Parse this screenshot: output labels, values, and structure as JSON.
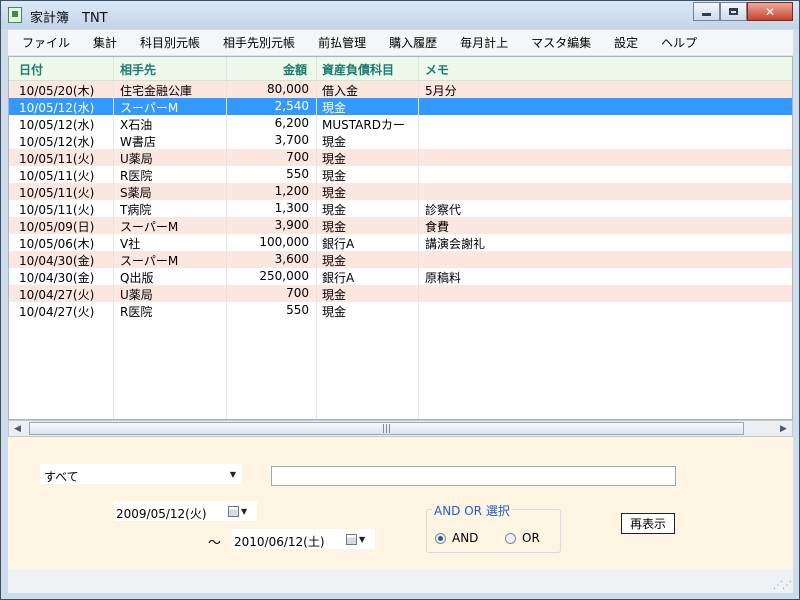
{
  "window": {
    "title": "家計簿　TNT"
  },
  "menu": [
    "ファイル",
    "集計",
    "科目別元帳",
    "相手先別元帳",
    "前払管理",
    "購入履歴",
    "毎月計上",
    "マスタ編集",
    "設定",
    "ヘルプ"
  ],
  "grid": {
    "headers": {
      "date": "日付",
      "partner": "相手先",
      "amount": "金額",
      "account": "資産負債科目",
      "memo": "メモ"
    },
    "rows": [
      {
        "date": "10/05/20(木)",
        "partner": "住宅金融公庫",
        "amount": "80,000",
        "account": "借入金",
        "memo": " 5月分",
        "style": "pink"
      },
      {
        "date": "10/05/12(水)",
        "partner": "スーパーM",
        "amount": "2,540",
        "account": "現金",
        "memo": "",
        "style": "sel"
      },
      {
        "date": "10/05/12(水)",
        "partner": "X石油",
        "amount": "6,200",
        "account": "MUSTARDカー",
        "memo": "",
        "style": "white"
      },
      {
        "date": "10/05/12(水)",
        "partner": "W書店",
        "amount": "3,700",
        "account": "現金",
        "memo": "",
        "style": "white"
      },
      {
        "date": "10/05/11(火)",
        "partner": "U薬局",
        "amount": "700",
        "account": "現金",
        "memo": "",
        "style": "pink"
      },
      {
        "date": "10/05/11(火)",
        "partner": "R医院",
        "amount": "550",
        "account": "現金",
        "memo": "",
        "style": "white"
      },
      {
        "date": "10/05/11(火)",
        "partner": "S薬局",
        "amount": "1,200",
        "account": "現金",
        "memo": "",
        "style": "pink"
      },
      {
        "date": "10/05/11(火)",
        "partner": "T病院",
        "amount": "1,300",
        "account": "現金",
        "memo": "診察代",
        "style": "white"
      },
      {
        "date": "10/05/09(日)",
        "partner": "スーパーM",
        "amount": "3,900",
        "account": "現金",
        "memo": "食費",
        "style": "pink"
      },
      {
        "date": "10/05/06(木)",
        "partner": "V社",
        "amount": "100,000",
        "account": "銀行A",
        "memo": "講演会謝礼",
        "style": "white"
      },
      {
        "date": "10/04/30(金)",
        "partner": "スーパーM",
        "amount": "3,600",
        "account": "現金",
        "memo": "",
        "style": "pink"
      },
      {
        "date": "10/04/30(金)",
        "partner": "Q出版",
        "amount": "250,000",
        "account": "銀行A",
        "memo": "原稿料",
        "style": "white"
      },
      {
        "date": "10/04/27(火)",
        "partner": "U薬局",
        "amount": "700",
        "account": "現金",
        "memo": "",
        "style": "pink"
      },
      {
        "date": "10/04/27(火)",
        "partner": "R医院",
        "amount": "550",
        "account": "現金",
        "memo": "",
        "style": "white"
      }
    ]
  },
  "filters": {
    "category_selected": "すべて",
    "search_value": "",
    "date_from": "2009/05/12(火)",
    "date_to": "2010/06/12(土)",
    "range_separator": "～",
    "and_or_group": "AND OR 選択",
    "and_label": "AND",
    "or_label": "OR",
    "selected_mode": "AND",
    "refresh_label": "再表示"
  },
  "colors": {
    "header_bg": "#eef9ec",
    "header_text": "#1a7d6f",
    "row_alt": "#fbe6e0",
    "selection": "#3399ff",
    "panel_bg": "#fdf5e1"
  }
}
